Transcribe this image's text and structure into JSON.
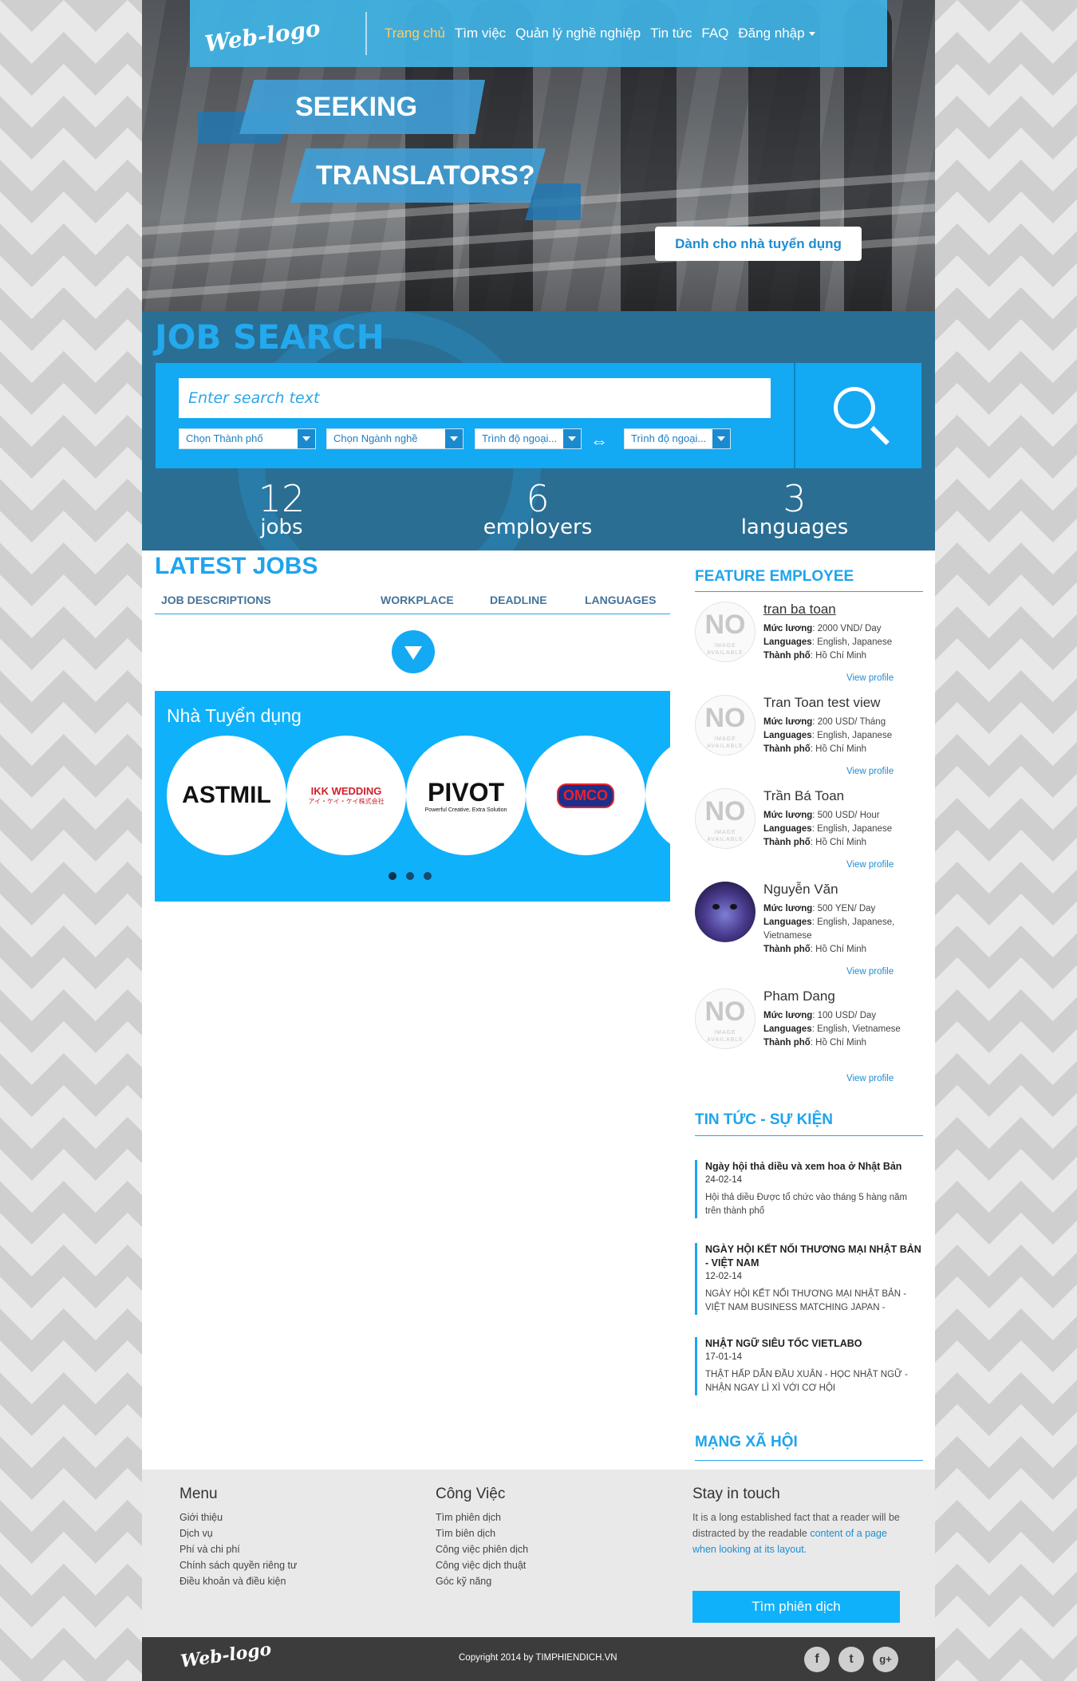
{
  "header": {
    "logo_text": "Web-logo",
    "nav": [
      {
        "label": "Trang chủ",
        "active": true
      },
      {
        "label": "Tìm việc"
      },
      {
        "label": "Quản lý nghề nghiệp"
      },
      {
        "label": "Tin tức"
      },
      {
        "label": "FAQ"
      },
      {
        "label": "Đăng nhập"
      }
    ]
  },
  "hero": {
    "line1": "SEEKING",
    "line2": "TRANSLATORS?",
    "employer_button": "Dành cho nhà tuyển dụng"
  },
  "search": {
    "title": "JOB SEARCH",
    "placeholder": "Enter search text",
    "selects": [
      "Chọn Thành phố",
      "Chọn Ngành nghề",
      "Trình độ ngoại...",
      "Trình độ ngoại..."
    ]
  },
  "stats": [
    {
      "number": "12",
      "label": "jobs"
    },
    {
      "number": "6",
      "label": "employers"
    },
    {
      "number": "3",
      "label": "languages"
    }
  ],
  "latest_jobs": {
    "title": "LATEST JOBS",
    "columns": [
      "JOB DESCRIPTIONS",
      "WORKPLACE",
      "DEADLINE",
      "LANGUAGES"
    ]
  },
  "employers": {
    "title": "Nhà Tuyển dụng",
    "logos": [
      "ASTMIL",
      "IKK WEDDING",
      "PIVOT",
      "OMCO"
    ],
    "ikk_sub": "アイ・ケイ・ケイ株式会社",
    "pivot_sub": "Powerful Creative, Extra Solution"
  },
  "feature_employee": {
    "title": "FEATURE EMPLOYEE",
    "no_image": "NO",
    "no_image_sub": "IMAGE AVAILABLE",
    "salary_label": "Mức lương",
    "languages_label": "Languages",
    "city_label": "Thành phố",
    "view_profile": "View profile",
    "items": [
      {
        "name": "tran ba toan",
        "salary": "2000 VND/ Day",
        "languages": "English, Japanese",
        "city": "Hồ Chí Minh"
      },
      {
        "name": "Tran Toan test view",
        "salary": "200 USD/ Tháng",
        "languages": "English, Japanese",
        "city": "Hồ Chí Minh"
      },
      {
        "name": "Trần Bá Toan",
        "salary": "500 USD/ Hour",
        "languages": "English, Japanese",
        "city": "Hồ Chí Minh"
      },
      {
        "name": "Nguyễn Văn",
        "salary": "500 YEN/ Day",
        "languages": "English, Japanese, Vietnamese",
        "city": "Hồ Chí Minh"
      },
      {
        "name": "Pham Dang",
        "salary": "100 USD/ Day",
        "languages": "English, Vietnamese",
        "city": "Hồ Chí Minh"
      }
    ]
  },
  "news": {
    "title": "TIN TỨC - SỰ KIỆN",
    "items": [
      {
        "title": "Ngày hội thả diều và xem hoa ở Nhật Bản",
        "date": "24-02-14",
        "body": "Hội thả diều Được tổ chức vào tháng 5 hàng năm trên thành phố"
      },
      {
        "title": "NGÀY HỘI KẾT NỐI THƯƠNG MẠI NHẬT BẢN - VIỆT NAM",
        "date": "12-02-14",
        "body": "NGÀY HỘI KẾT NỐI THƯƠNG MẠI NHẬT BẢN - VIỆT NAM BUSINESS MATCHING JAPAN -"
      },
      {
        "title": "NHẬT NGỮ SIÊU TỐC VIETLABO",
        "date": "17-01-14",
        "body": "THẬT HẤP DẪN  ĐẦU XUÂN - HỌC NHẬT NGỮ - NHẬN NGAY LÌ XÌ VỚI CƠ HỘI"
      }
    ]
  },
  "social_title": "MẠNG XÃ HỘI",
  "footer": {
    "menu_title": "Menu",
    "menu": [
      "Giới thiệu",
      "Dịch vụ",
      "Phí và chi phí",
      "Chính sách quyền riêng tư",
      "Điều khoản và điều kiện"
    ],
    "jobs_title": "Công Việc",
    "jobs": [
      "Tìm phiên dịch",
      "Tìm biên dịch",
      "Công việc phiên dịch",
      "Công việc dịch thuật",
      "Góc kỹ năng"
    ],
    "stay_title": "Stay in touch",
    "stay_text_1": "It is a long established fact that a reader will be distracted by the readable",
    "stay_text_2": "content of a page when looking at its layout.",
    "find_button": "Tìm phiên dịch",
    "bottom_logo": "Web-logo",
    "copyright": "Copyright 2014 by TIMPHIENDICH.VN",
    "social": [
      "f",
      "t",
      "g+"
    ]
  }
}
